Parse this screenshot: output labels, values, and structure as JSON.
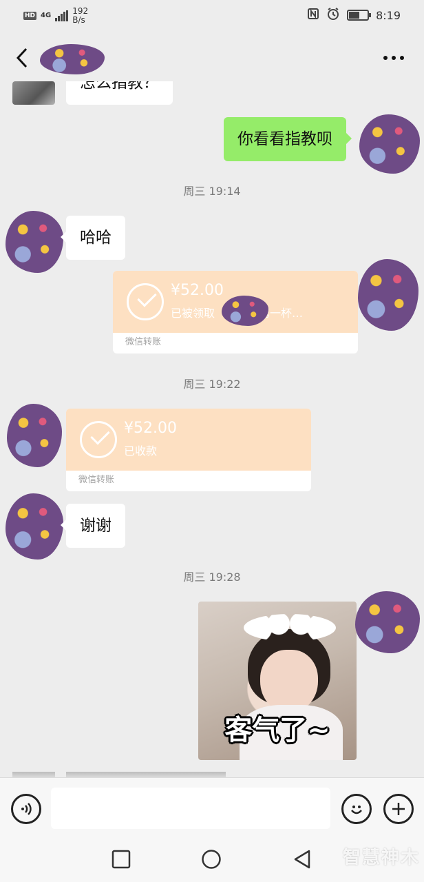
{
  "status_bar": {
    "hd": "HD",
    "network": "4G",
    "speed_value": "192",
    "speed_unit": "B/s",
    "time": "8:19",
    "battery_level": 0.55
  },
  "header": {
    "back_icon": "chevron-left-icon",
    "more_icon": "more-dots-icon"
  },
  "messages": {
    "m0_text": "怎么指教？",
    "m1_text": "你看看指教呗",
    "ts1": "周三 19:14",
    "m2_text": "哈哈",
    "t1_amount": "¥52.00",
    "t1_desc": "已被领取　　　的第一杯…",
    "t1_label": "微信转账",
    "ts2": "周三 19:22",
    "t2_amount": "¥52.00",
    "t2_desc": "已收款",
    "t2_label": "微信转账",
    "m3_text": "谢谢",
    "ts3": "周三 19:28",
    "sticker_caption": "客气了~"
  },
  "input_bar": {
    "voice_icon": "voice-icon",
    "emoji_icon": "emoji-icon",
    "plus_icon": "plus-icon",
    "input_value": ""
  },
  "nav_bar": {
    "recent_icon": "square-icon",
    "home_icon": "circle-icon",
    "back_icon": "triangle-back-icon"
  },
  "watermark": "智慧神木",
  "colors": {
    "background": "#ededed",
    "outgoing_bubble": "#95ec69",
    "incoming_bubble": "#ffffff",
    "transfer_card": "#fde0c2",
    "avatar_purple": "#6e4b86"
  }
}
